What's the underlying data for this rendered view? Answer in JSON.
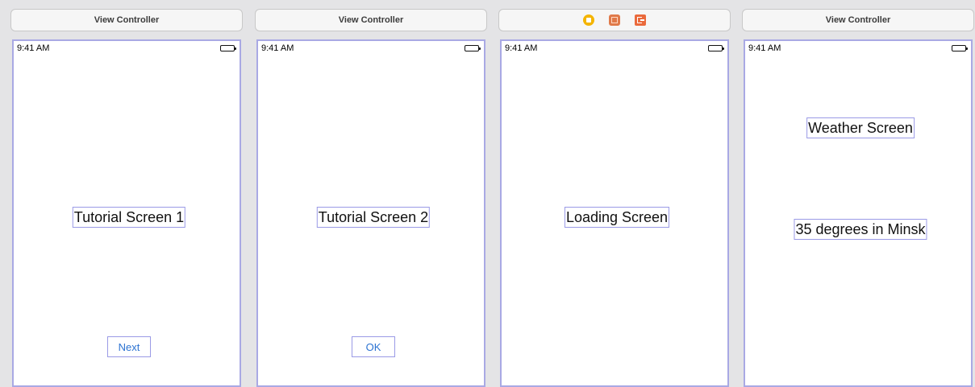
{
  "scenes": [
    {
      "dock_title": "View Controller",
      "time": "9:41 AM",
      "labels": [
        "Tutorial Screen 1"
      ],
      "button": "Next"
    },
    {
      "dock_title": "View Controller",
      "time": "9:41 AM",
      "labels": [
        "Tutorial Screen 2"
      ],
      "button": "OK"
    },
    {
      "dock_icons": [
        "view-controller-icon",
        "first-responder-icon",
        "exit-icon"
      ],
      "time": "9:41 AM",
      "labels": [
        "Loading Screen"
      ]
    },
    {
      "dock_title": "View Controller",
      "time": "9:41 AM",
      "labels": [
        "Weather Screen",
        "35 degrees in Minsk"
      ]
    }
  ],
  "colors": {
    "canvas": "#e4e4e6",
    "device_border": "#a9a9e4",
    "button_text": "#2c73d2",
    "vc_icon": "#f4b400",
    "responder_icon": "#e07a4a",
    "exit_icon": "#ea6a3c"
  }
}
